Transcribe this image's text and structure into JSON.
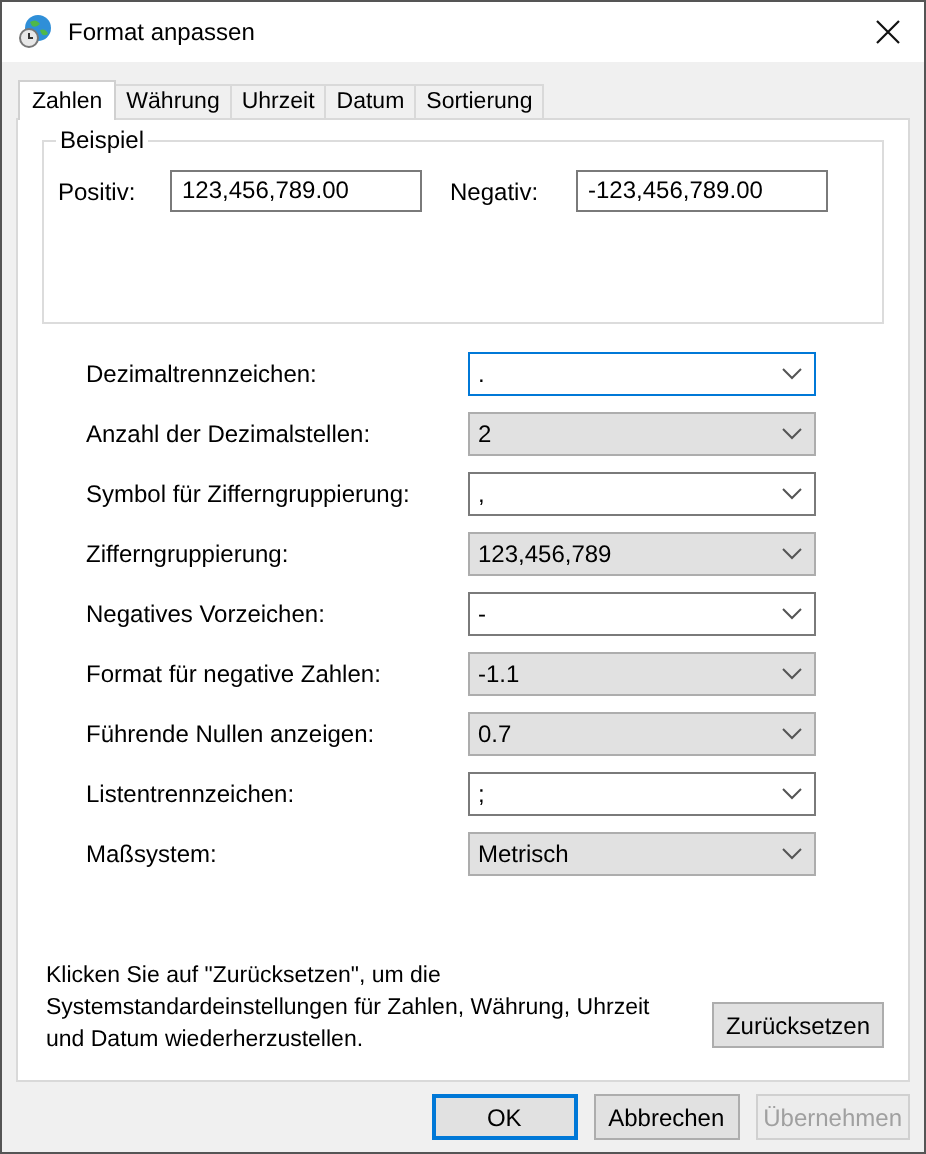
{
  "window": {
    "title": "Format anpassen"
  },
  "tabs": [
    {
      "label": "Zahlen",
      "selected": true
    },
    {
      "label": "Währung",
      "selected": false
    },
    {
      "label": "Uhrzeit",
      "selected": false
    },
    {
      "label": "Datum",
      "selected": false
    },
    {
      "label": "Sortierung",
      "selected": false
    }
  ],
  "example": {
    "title": "Beispiel",
    "positive_label": "Positiv:",
    "positive_value": "123,456,789.00",
    "negative_label": "Negativ:",
    "negative_value": "-123,456,789.00"
  },
  "settings": [
    {
      "label": "Dezimaltrennzeichen:",
      "value": ".",
      "kind": "editable",
      "focused": true
    },
    {
      "label": "Anzahl der Dezimalstellen:",
      "value": "2",
      "kind": "list",
      "focused": false
    },
    {
      "label": "Symbol für Zifferngruppierung:",
      "value": ",",
      "kind": "editable",
      "focused": false
    },
    {
      "label": "Zifferngruppierung:",
      "value": "123,456,789",
      "kind": "list",
      "focused": false
    },
    {
      "label": "Negatives Vorzeichen:",
      "value": "-",
      "kind": "editable",
      "focused": false
    },
    {
      "label": "Format für negative Zahlen:",
      "value": "-1.1",
      "kind": "list",
      "focused": false
    },
    {
      "label": "Führende Nullen anzeigen:",
      "value": "0.7",
      "kind": "list",
      "focused": false
    },
    {
      "label": "Listentrennzeichen:",
      "value": ";",
      "kind": "editable",
      "focused": false
    },
    {
      "label": "Maßsystem:",
      "value": "Metrisch",
      "kind": "list",
      "focused": false
    }
  ],
  "reset_text": "Klicken Sie auf \"Zurücksetzen\", um die Systemstandardeinstellungen für Zahlen, Währung, Uhrzeit und Datum wiederherzustellen.",
  "reset_button": "Zurücksetzen",
  "buttons": [
    {
      "label": "OK",
      "default": true,
      "disabled": false
    },
    {
      "label": "Abbrechen",
      "default": false,
      "disabled": false
    },
    {
      "label": "Übernehmen",
      "default": false,
      "disabled": true
    }
  ]
}
